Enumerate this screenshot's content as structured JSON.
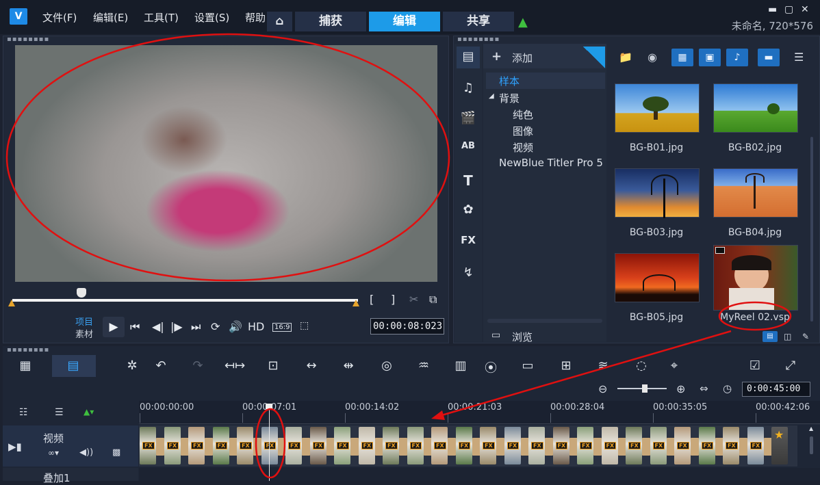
{
  "app": {
    "logo_text": "V",
    "menu": [
      "文件(F)",
      "编辑(E)",
      "工具(T)",
      "设置(S)",
      "帮助"
    ],
    "tabs": [
      "捕获",
      "编辑",
      "共享"
    ],
    "active_tab": "编辑",
    "project_info": "未命名, 720*576",
    "window_controls": [
      "minimize-icon",
      "maximize-icon",
      "close-icon"
    ]
  },
  "preview": {
    "mode_project": "项目",
    "mode_clip": "素材",
    "hd_label": "HD",
    "aspect_label": "16:9",
    "timecode": "00:00:08:023",
    "playback_position": 0.2,
    "mark_in": "[",
    "mark_out": "]"
  },
  "library": {
    "add_label": "添加",
    "tree": {
      "sample": "样本",
      "background": "背景",
      "children": [
        "纯色",
        "图像",
        "视频"
      ],
      "plugin": "NewBlue Titler Pro 5"
    },
    "browse_label": "浏览",
    "thumbnails": [
      {
        "label": "BG-B01.jpg",
        "scene": "tree-field"
      },
      {
        "label": "BG-B02.jpg",
        "scene": "green-hill"
      },
      {
        "label": "BG-B03.jpg",
        "scene": "sunset-tree"
      },
      {
        "label": "BG-B04.jpg",
        "scene": "desert-tree"
      },
      {
        "label": "BG-B05.jpg",
        "scene": "red-sunset"
      },
      {
        "label": "MyReel 02.vsp",
        "scene": "child-photo"
      }
    ]
  },
  "timeline": {
    "total_time": "0:00:45:00",
    "ruler": [
      "00:00:00:00",
      "00:00:07:01",
      "00:00:14:02",
      "00:00:21:03",
      "00:00:28:04",
      "00:00:35:05",
      "00:00:42:06"
    ],
    "ruler_display": [
      "00:00:00:00",
      "00:00:07:01",
      "00:00:14:02",
      "00:00:21:03",
      "00:00:28:04",
      "00:00:35:05",
      "00:00:42:06"
    ],
    "tracks": [
      {
        "name": "视频"
      },
      {
        "name": "叠加1"
      }
    ],
    "clip_count": 27,
    "clip_fx_label": "FX",
    "playhead_time": "00:00:07:01"
  },
  "colors": {
    "accent": "#1d9be8",
    "annotation": "#e01010",
    "scrub_handle": "#e6a42c"
  }
}
